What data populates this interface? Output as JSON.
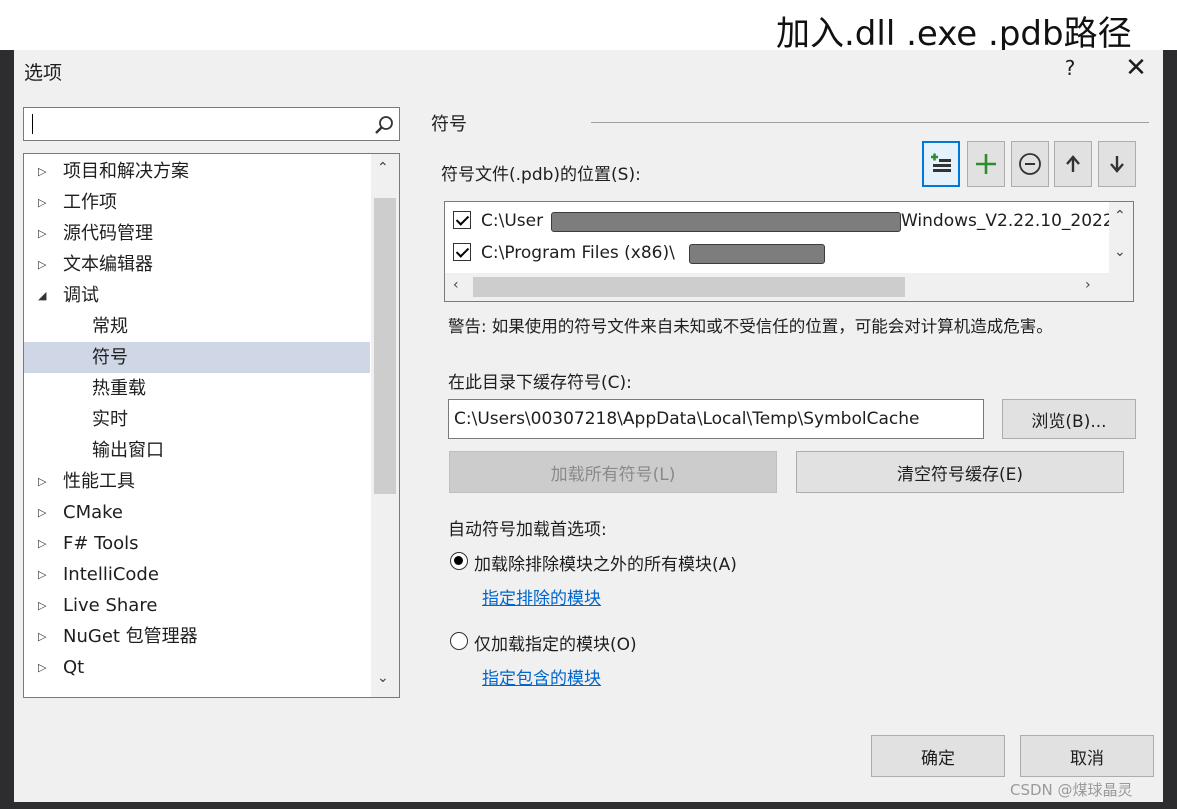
{
  "annotation": {
    "text": "加入.dll .exe .pdb路径"
  },
  "dialog": {
    "title": "选项",
    "help": "?",
    "close": "✕"
  },
  "search": {
    "value": "",
    "placeholder": ""
  },
  "tree": {
    "items": [
      {
        "label": "项目和解决方案",
        "expander": "▷",
        "child": false,
        "selected": false
      },
      {
        "label": "工作项",
        "expander": "▷",
        "child": false,
        "selected": false
      },
      {
        "label": "源代码管理",
        "expander": "▷",
        "child": false,
        "selected": false
      },
      {
        "label": "文本编辑器",
        "expander": "▷",
        "child": false,
        "selected": false
      },
      {
        "label": "调试",
        "expander": "◢",
        "child": false,
        "selected": false
      },
      {
        "label": "常规",
        "expander": "",
        "child": true,
        "selected": false
      },
      {
        "label": "符号",
        "expander": "",
        "child": true,
        "selected": true
      },
      {
        "label": "热重载",
        "expander": "",
        "child": true,
        "selected": false
      },
      {
        "label": "实时",
        "expander": "",
        "child": true,
        "selected": false
      },
      {
        "label": "输出窗口",
        "expander": "",
        "child": true,
        "selected": false
      },
      {
        "label": "性能工具",
        "expander": "▷",
        "child": false,
        "selected": false
      },
      {
        "label": "CMake",
        "expander": "▷",
        "child": false,
        "selected": false
      },
      {
        "label": "F# Tools",
        "expander": "▷",
        "child": false,
        "selected": false
      },
      {
        "label": "IntelliCode",
        "expander": "▷",
        "child": false,
        "selected": false
      },
      {
        "label": "Live Share",
        "expander": "▷",
        "child": false,
        "selected": false
      },
      {
        "label": "NuGet 包管理器",
        "expander": "▷",
        "child": false,
        "selected": false
      },
      {
        "label": "Qt",
        "expander": "▷",
        "child": false,
        "selected": false
      }
    ]
  },
  "symbols": {
    "section_title": "符号",
    "locations_label": "符号文件(.pdb)的位置(S):",
    "rows": [
      {
        "checked": true,
        "prefix": "C:\\User",
        "suffix": "Windows_V2.22.10_2022"
      },
      {
        "checked": true,
        "prefix": "C:\\Program Files (x86)\\",
        "suffix": ""
      }
    ],
    "warning": "警告: 如果使用的符号文件来自未知或不受信任的位置，可能会对计算机造成危害。",
    "cache_label": "在此目录下缓存符号(C):",
    "cache_path": "C:\\Users\\00307218\\AppData\\Local\\Temp\\SymbolCache",
    "browse": "浏览(B)...",
    "load_all": "加载所有符号(L)",
    "clear_cache": "清空符号缓存(E)",
    "auto_load_label": "自动符号加载首选项:",
    "option_all": "加载除排除模块之外的所有模块(A)",
    "link_exclude": "指定排除的模块",
    "option_specified": "仅加载指定的模块(O)",
    "link_include": "指定包含的模块"
  },
  "footer": {
    "ok": "确定",
    "cancel": "取消"
  },
  "watermark": "CSDN @煤球晶灵",
  "colors": {
    "accent": "#0078d7",
    "arrow": "#c00000",
    "add_green": "#2e8b2e"
  }
}
